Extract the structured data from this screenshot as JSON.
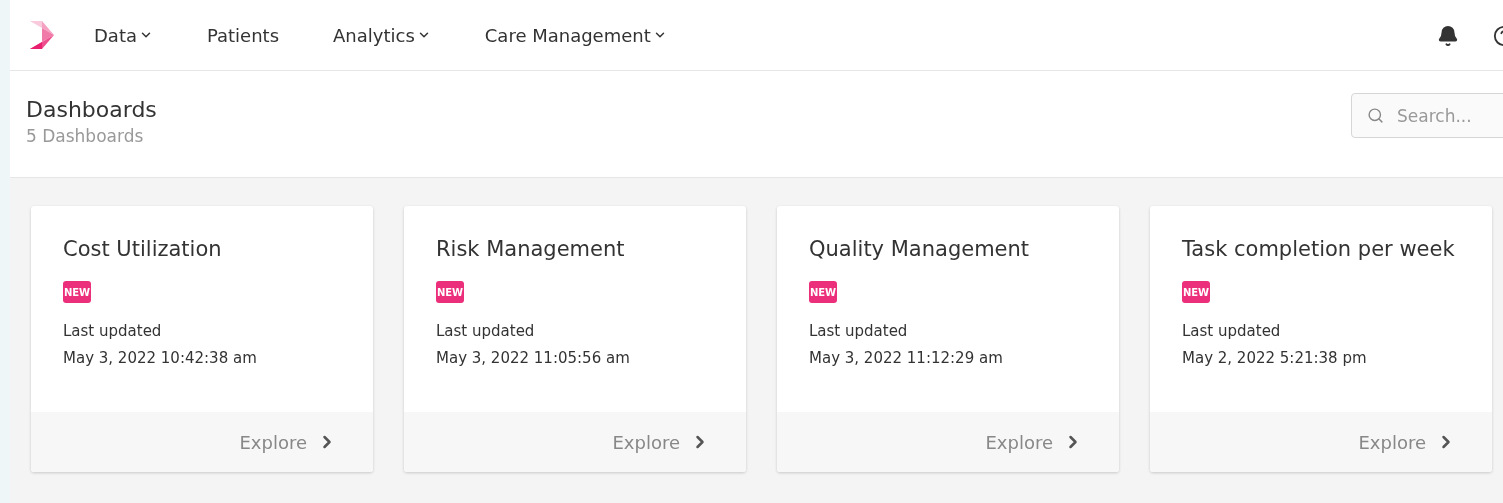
{
  "nav": {
    "items": [
      {
        "label": "Data",
        "dropdown": true
      },
      {
        "label": "Patients",
        "dropdown": false
      },
      {
        "label": "Analytics",
        "dropdown": true
      },
      {
        "label": "Care Management",
        "dropdown": true
      }
    ]
  },
  "header": {
    "title": "Dashboards",
    "subtitle": "5 Dashboards",
    "search": {
      "placeholder": "Search..."
    }
  },
  "cards": [
    {
      "title": "Cost Utilization",
      "badge": "NEW",
      "updated_label": "Last updated",
      "updated": "May 3, 2022 10:42:38 am",
      "action": "Explore"
    },
    {
      "title": "Risk Management",
      "badge": "NEW",
      "updated_label": "Last updated",
      "updated": "May 3, 2022 11:05:56 am",
      "action": "Explore"
    },
    {
      "title": "Quality Management",
      "badge": "NEW",
      "updated_label": "Last updated",
      "updated": "May 3, 2022 11:12:29 am",
      "action": "Explore"
    },
    {
      "title": "Task completion per week",
      "badge": "NEW",
      "updated_label": "Last updated",
      "updated": "May 2, 2022 5:21:38 pm",
      "action": "Explore"
    }
  ]
}
